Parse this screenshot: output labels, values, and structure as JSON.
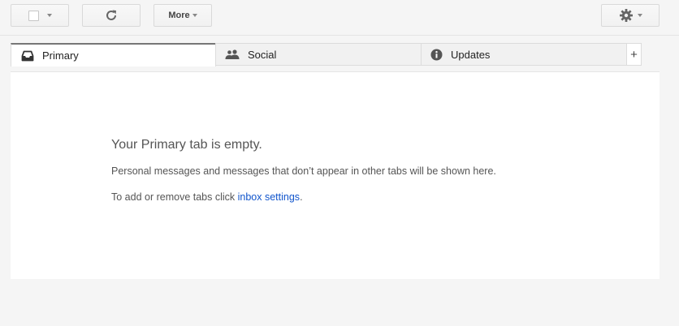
{
  "toolbar": {
    "more_label": "More"
  },
  "tabs": [
    {
      "label": "Primary",
      "icon": "inbox-icon",
      "active": true
    },
    {
      "label": "Social",
      "icon": "people-icon",
      "active": false
    },
    {
      "label": "Updates",
      "icon": "info-icon",
      "active": false
    }
  ],
  "add_tab_label": "+",
  "empty_state": {
    "title": "Your Primary tab is empty.",
    "description": "Personal messages and messages that don’t appear in other tabs will be shown here.",
    "hint_prefix": "To add or remove tabs click ",
    "hint_link": "inbox settings",
    "hint_suffix": "."
  },
  "colors": {
    "link": "#1155cc",
    "active_tab_border": "#777777"
  }
}
